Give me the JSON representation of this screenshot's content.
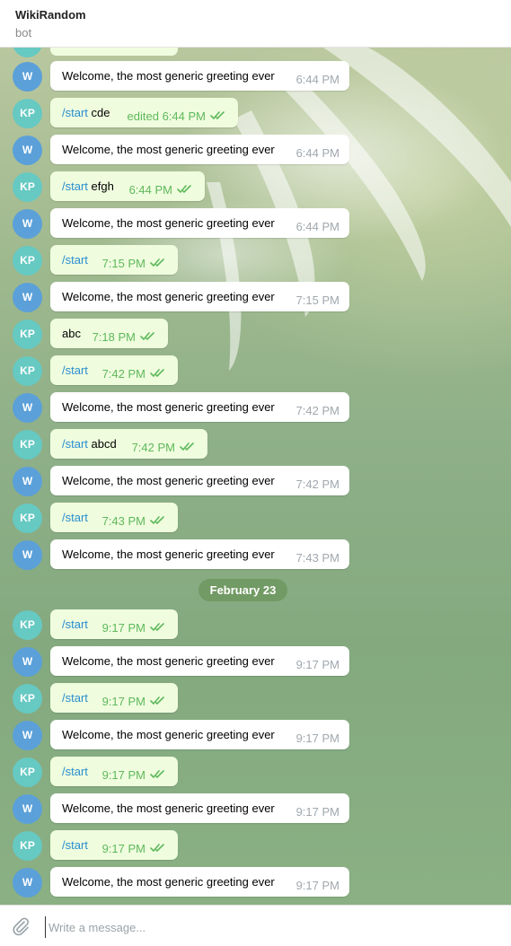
{
  "header": {
    "title": "WikiRandom",
    "subtitle": "bot"
  },
  "date_separator": "February 23",
  "composer": {
    "placeholder": "Write a message..."
  },
  "messages": [
    {
      "sender": "bot",
      "avatar": "W",
      "text": "Welcome, the most generic greeting ever",
      "time": "6:44 PM"
    },
    {
      "sender": "user",
      "avatar": "KP",
      "command": "/start",
      "arg": " cde",
      "time": "edited 6:44 PM",
      "read": true
    },
    {
      "sender": "bot",
      "avatar": "W",
      "text": "Welcome, the most generic greeting ever",
      "time": "6:44 PM"
    },
    {
      "sender": "user",
      "avatar": "KP",
      "command": "/start",
      "arg": " efgh",
      "time": "6:44 PM",
      "read": true
    },
    {
      "sender": "bot",
      "avatar": "W",
      "text": "Welcome, the most generic greeting ever",
      "time": "6:44 PM"
    },
    {
      "sender": "user",
      "avatar": "KP",
      "command": "/start",
      "arg": "",
      "time": "7:15 PM",
      "read": true
    },
    {
      "sender": "bot",
      "avatar": "W",
      "text": "Welcome, the most generic greeting ever",
      "time": "7:15 PM"
    },
    {
      "sender": "user",
      "avatar": "KP",
      "command": "",
      "arg": "abc",
      "time": "7:18 PM",
      "read": true
    },
    {
      "sender": "user",
      "avatar": "KP",
      "command": "/start",
      "arg": "",
      "time": "7:42 PM",
      "read": true
    },
    {
      "sender": "bot",
      "avatar": "W",
      "text": "Welcome, the most generic greeting ever",
      "time": "7:42 PM"
    },
    {
      "sender": "user",
      "avatar": "KP",
      "command": "/start",
      "arg": " abcd",
      "time": "7:42 PM",
      "read": true
    },
    {
      "sender": "bot",
      "avatar": "W",
      "text": "Welcome, the most generic greeting ever",
      "time": "7:42 PM"
    },
    {
      "sender": "user",
      "avatar": "KP",
      "command": "/start",
      "arg": "",
      "time": "7:43 PM",
      "read": true
    },
    {
      "sender": "bot",
      "avatar": "W",
      "text": "Welcome, the most generic greeting ever",
      "time": "7:43 PM"
    },
    {
      "sender": "user",
      "avatar": "KP",
      "command": "/start",
      "arg": "",
      "time": "9:17 PM",
      "read": true
    },
    {
      "sender": "bot",
      "avatar": "W",
      "text": "Welcome, the most generic greeting ever",
      "time": "9:17 PM"
    },
    {
      "sender": "user",
      "avatar": "KP",
      "command": "/start",
      "arg": "",
      "time": "9:17 PM",
      "read": true
    },
    {
      "sender": "bot",
      "avatar": "W",
      "text": "Welcome, the most generic greeting ever",
      "time": "9:17 PM"
    },
    {
      "sender": "user",
      "avatar": "KP",
      "command": "/start",
      "arg": "",
      "time": "9:17 PM",
      "read": true
    },
    {
      "sender": "bot",
      "avatar": "W",
      "text": "Welcome, the most generic greeting ever",
      "time": "9:17 PM"
    },
    {
      "sender": "user",
      "avatar": "KP",
      "command": "/start",
      "arg": "",
      "time": "9:17 PM",
      "read": true
    },
    {
      "sender": "bot",
      "avatar": "W",
      "text": "Welcome, the most generic greeting ever",
      "time": "9:17 PM"
    }
  ],
  "colors": {
    "bot_avatar": "#5ba0d9",
    "user_avatar": "#66c9c2",
    "outgoing_bubble": "#effdde",
    "incoming_bubble": "#ffffff",
    "command_link": "#2a8dd0",
    "outgoing_time": "#5fb85c"
  }
}
